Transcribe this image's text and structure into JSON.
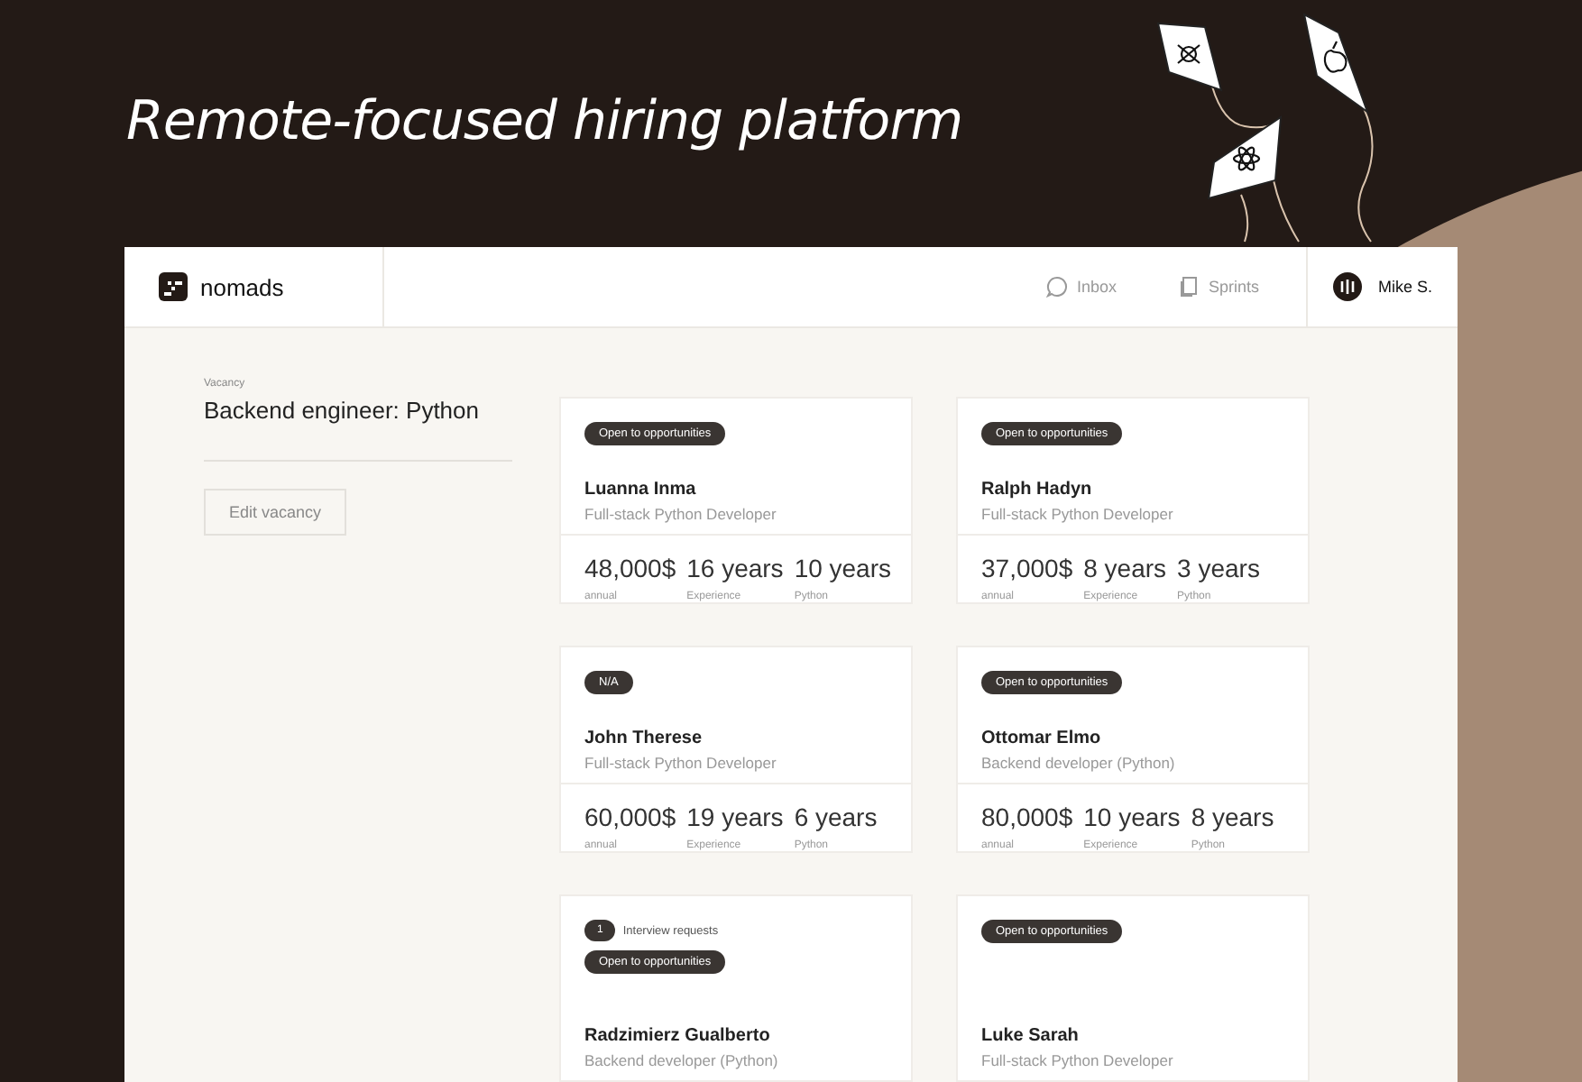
{
  "headline": "Remote-focused hiring platform",
  "brand": {
    "name": "nomads"
  },
  "nav": [
    {
      "label": "Inbox",
      "kind": "chat"
    },
    {
      "label": "Sprints",
      "kind": "pages"
    }
  ],
  "user": {
    "name": "Mike S."
  },
  "vacancy": {
    "caption": "Vacancy",
    "title": "Backend engineer: Python",
    "edit_button": "Edit vacancy"
  },
  "candidates": [
    {
      "badge": "Open to opportunities",
      "name": "Luanna Inma",
      "role": "Full-stack Python Developer",
      "stats": [
        {
          "value": "48,000$",
          "label": "annual"
        },
        {
          "value": "16 years",
          "label": "Experience"
        },
        {
          "value": "10 years",
          "label": "Python"
        }
      ]
    },
    {
      "badge": "Open to opportunities",
      "name": "Ralph Hadyn",
      "role": "Full-stack Python Developer",
      "stats": [
        {
          "value": "37,000$",
          "label": "annual"
        },
        {
          "value": "8 years",
          "label": "Experience"
        },
        {
          "value": "3 years",
          "label": "Python"
        }
      ]
    },
    {
      "badge": "N/A",
      "name": "John Therese",
      "role": "Full-stack Python Developer",
      "stats": [
        {
          "value": "60,000$",
          "label": "annual"
        },
        {
          "value": "19 years",
          "label": "Experience"
        },
        {
          "value": "6 years",
          "label": "Python"
        }
      ]
    },
    {
      "badge": "Open to opportunities",
      "name": "Ottomar Elmo",
      "role": "Backend developer (Python)",
      "stats": [
        {
          "value": "80,000$",
          "label": "annual"
        },
        {
          "value": "10 years",
          "label": "Experience"
        },
        {
          "value": "8 years",
          "label": "Python"
        }
      ]
    },
    {
      "interview_requests": {
        "count": "1",
        "label": "Interview requests"
      },
      "badge": "Open to opportunities",
      "name": "Radzimierz Gualberto",
      "role": "Backend developer (Python)"
    },
    {
      "badge": "Open to opportunities",
      "name": "Luke Sarah",
      "role": "Full-stack Python Developer"
    }
  ]
}
